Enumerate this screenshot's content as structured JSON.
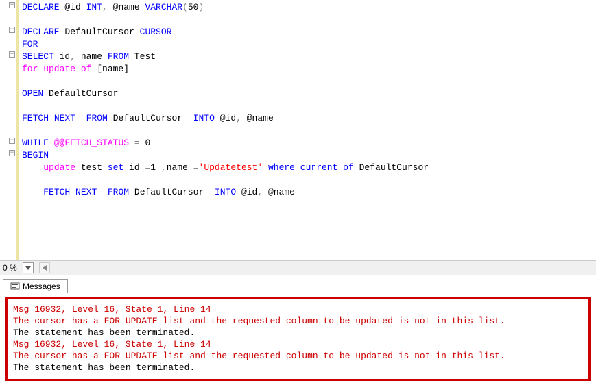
{
  "code": {
    "lines": [
      {
        "outline": "minus",
        "segs": [
          {
            "t": "DECLARE",
            "c": "kw-blue"
          },
          {
            "t": " @id ",
            "c": "kw-black"
          },
          {
            "t": "INT",
            "c": "kw-blue"
          },
          {
            "t": ",",
            "c": "kw-gray"
          },
          {
            "t": " @name ",
            "c": "kw-black"
          },
          {
            "t": "VARCHAR",
            "c": "kw-blue"
          },
          {
            "t": "(",
            "c": "kw-gray"
          },
          {
            "t": "50",
            "c": "kw-black"
          },
          {
            "t": ")",
            "c": "kw-gray"
          }
        ]
      },
      {
        "outline": "line",
        "segs": []
      },
      {
        "outline": "minus",
        "segs": [
          {
            "t": "DECLARE",
            "c": "kw-blue"
          },
          {
            "t": " DefaultCursor ",
            "c": "kw-black"
          },
          {
            "t": "CURSOR",
            "c": "kw-blue"
          }
        ]
      },
      {
        "outline": "line",
        "segs": [
          {
            "t": "FOR",
            "c": "kw-blue"
          }
        ]
      },
      {
        "outline": "minus",
        "segs": [
          {
            "t": "SELECT",
            "c": "kw-blue"
          },
          {
            "t": " id",
            "c": "kw-black"
          },
          {
            "t": ",",
            "c": "kw-gray"
          },
          {
            "t": " name ",
            "c": "kw-black"
          },
          {
            "t": "FROM",
            "c": "kw-blue"
          },
          {
            "t": " Test",
            "c": "kw-black"
          }
        ]
      },
      {
        "outline": "line",
        "segs": [
          {
            "t": "for update of",
            "c": "kw-magenta"
          },
          {
            "t": " [name]",
            "c": "kw-black"
          }
        ]
      },
      {
        "outline": "line",
        "segs": []
      },
      {
        "outline": "line",
        "segs": [
          {
            "t": "OPEN",
            "c": "kw-blue"
          },
          {
            "t": " DefaultCursor",
            "c": "kw-black"
          }
        ]
      },
      {
        "outline": "line",
        "segs": []
      },
      {
        "outline": "line",
        "segs": [
          {
            "t": "FETCH",
            "c": "kw-blue"
          },
          {
            "t": " ",
            "c": ""
          },
          {
            "t": "NEXT",
            "c": "kw-blue"
          },
          {
            "t": "  ",
            "c": ""
          },
          {
            "t": "FROM",
            "c": "kw-blue"
          },
          {
            "t": " DefaultCursor  ",
            "c": "kw-black"
          },
          {
            "t": "INTO",
            "c": "kw-blue"
          },
          {
            "t": " @id",
            "c": "kw-black"
          },
          {
            "t": ",",
            "c": "kw-gray"
          },
          {
            "t": " @name",
            "c": "kw-black"
          }
        ]
      },
      {
        "outline": "line",
        "segs": []
      },
      {
        "outline": "minus",
        "segs": [
          {
            "t": "WHILE",
            "c": "kw-blue"
          },
          {
            "t": " ",
            "c": ""
          },
          {
            "t": "@@FETCH_STATUS",
            "c": "kw-magenta"
          },
          {
            "t": " ",
            "c": ""
          },
          {
            "t": "=",
            "c": "kw-gray"
          },
          {
            "t": " 0",
            "c": "kw-black"
          }
        ]
      },
      {
        "outline": "minus",
        "segs": [
          {
            "t": "BEGIN",
            "c": "kw-blue"
          }
        ]
      },
      {
        "outline": "line",
        "segs": [
          {
            "t": "    ",
            "c": ""
          },
          {
            "t": "update",
            "c": "kw-magenta"
          },
          {
            "t": " test ",
            "c": "kw-black"
          },
          {
            "t": "set",
            "c": "kw-blue"
          },
          {
            "t": " id ",
            "c": "kw-black"
          },
          {
            "t": "=",
            "c": "kw-gray"
          },
          {
            "t": "1 ",
            "c": "kw-black"
          },
          {
            "t": ",",
            "c": "kw-gray"
          },
          {
            "t": "name ",
            "c": "kw-black"
          },
          {
            "t": "=",
            "c": "kw-gray"
          },
          {
            "t": "'Updatetest'",
            "c": "str-red"
          },
          {
            "t": " ",
            "c": ""
          },
          {
            "t": "where",
            "c": "kw-blue"
          },
          {
            "t": " ",
            "c": ""
          },
          {
            "t": "current",
            "c": "kw-blue"
          },
          {
            "t": " ",
            "c": ""
          },
          {
            "t": "of",
            "c": "kw-blue"
          },
          {
            "t": " DefaultCursor",
            "c": "kw-black"
          }
        ]
      },
      {
        "outline": "line",
        "segs": []
      },
      {
        "outline": "line",
        "segs": [
          {
            "t": "    ",
            "c": ""
          },
          {
            "t": "FETCH",
            "c": "kw-blue"
          },
          {
            "t": " ",
            "c": ""
          },
          {
            "t": "NEXT",
            "c": "kw-blue"
          },
          {
            "t": "  ",
            "c": ""
          },
          {
            "t": "FROM",
            "c": "kw-blue"
          },
          {
            "t": " DefaultCursor  ",
            "c": "kw-black"
          },
          {
            "t": "INTO",
            "c": "kw-blue"
          },
          {
            "t": " @id",
            "c": "kw-black"
          },
          {
            "t": ",",
            "c": "kw-gray"
          },
          {
            "t": " @name",
            "c": "kw-black"
          }
        ]
      }
    ]
  },
  "zoom": "0 %",
  "tab_label": "Messages",
  "messages": {
    "l1": "Msg 16932, Level 16, State 1, Line 14",
    "l2": "The cursor has a FOR UPDATE list and the requested column to be updated is not in this list.",
    "l3": "The statement has been terminated.",
    "l4": "Msg 16932, Level 16, State 1, Line 14",
    "l5": "The cursor has a FOR UPDATE list and the requested column to be updated is not in this list.",
    "l6": "The statement has been terminated."
  }
}
